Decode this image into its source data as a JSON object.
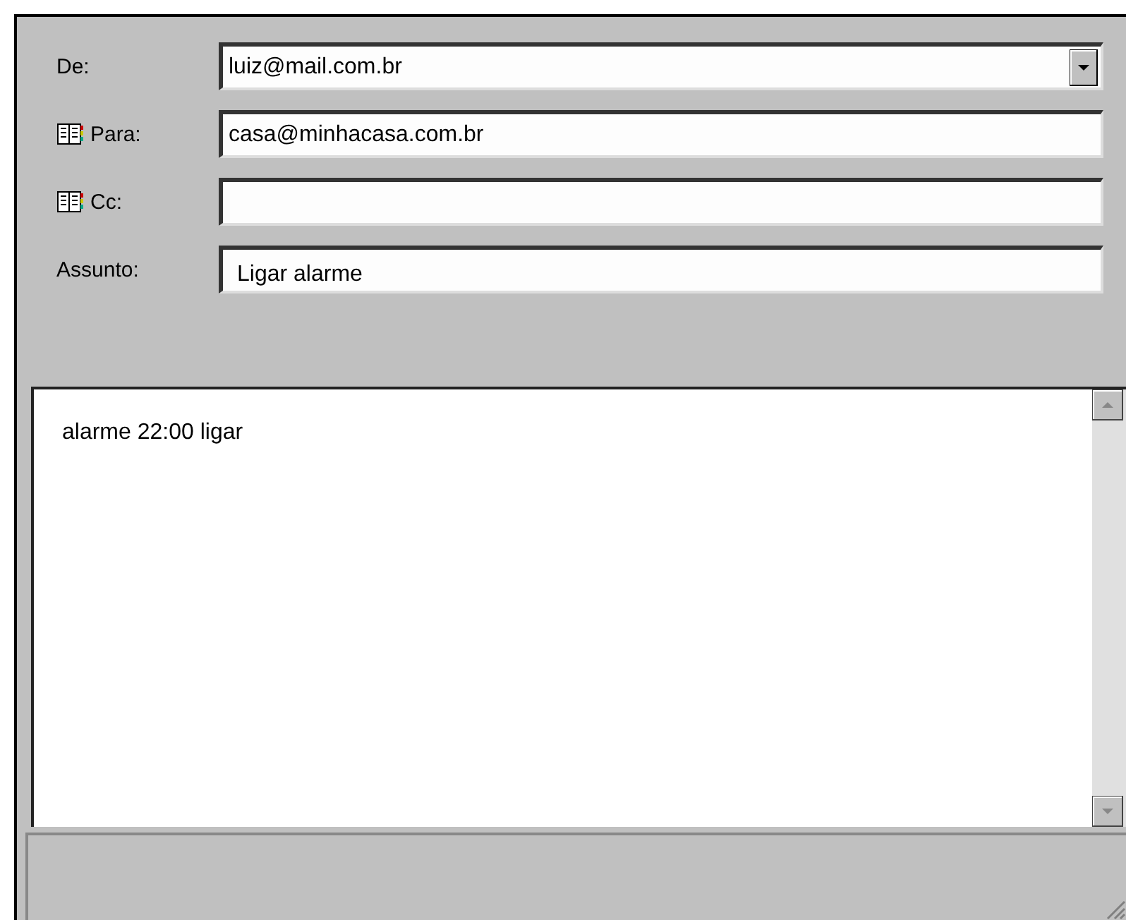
{
  "header": {
    "fields": [
      {
        "label": "De:",
        "value": "luiz@mail.com.br",
        "kind": "dropdown"
      },
      {
        "label": "Para:",
        "value": "casa@minhacasa.com.br",
        "kind": "address"
      },
      {
        "label": "Cc:",
        "kind": "address"
      },
      {
        "label": "Assunto:",
        "value": "Ligar alarme",
        "kind": "text"
      }
    ]
  },
  "body": {
    "text": "alarme 22:00 ligar"
  }
}
